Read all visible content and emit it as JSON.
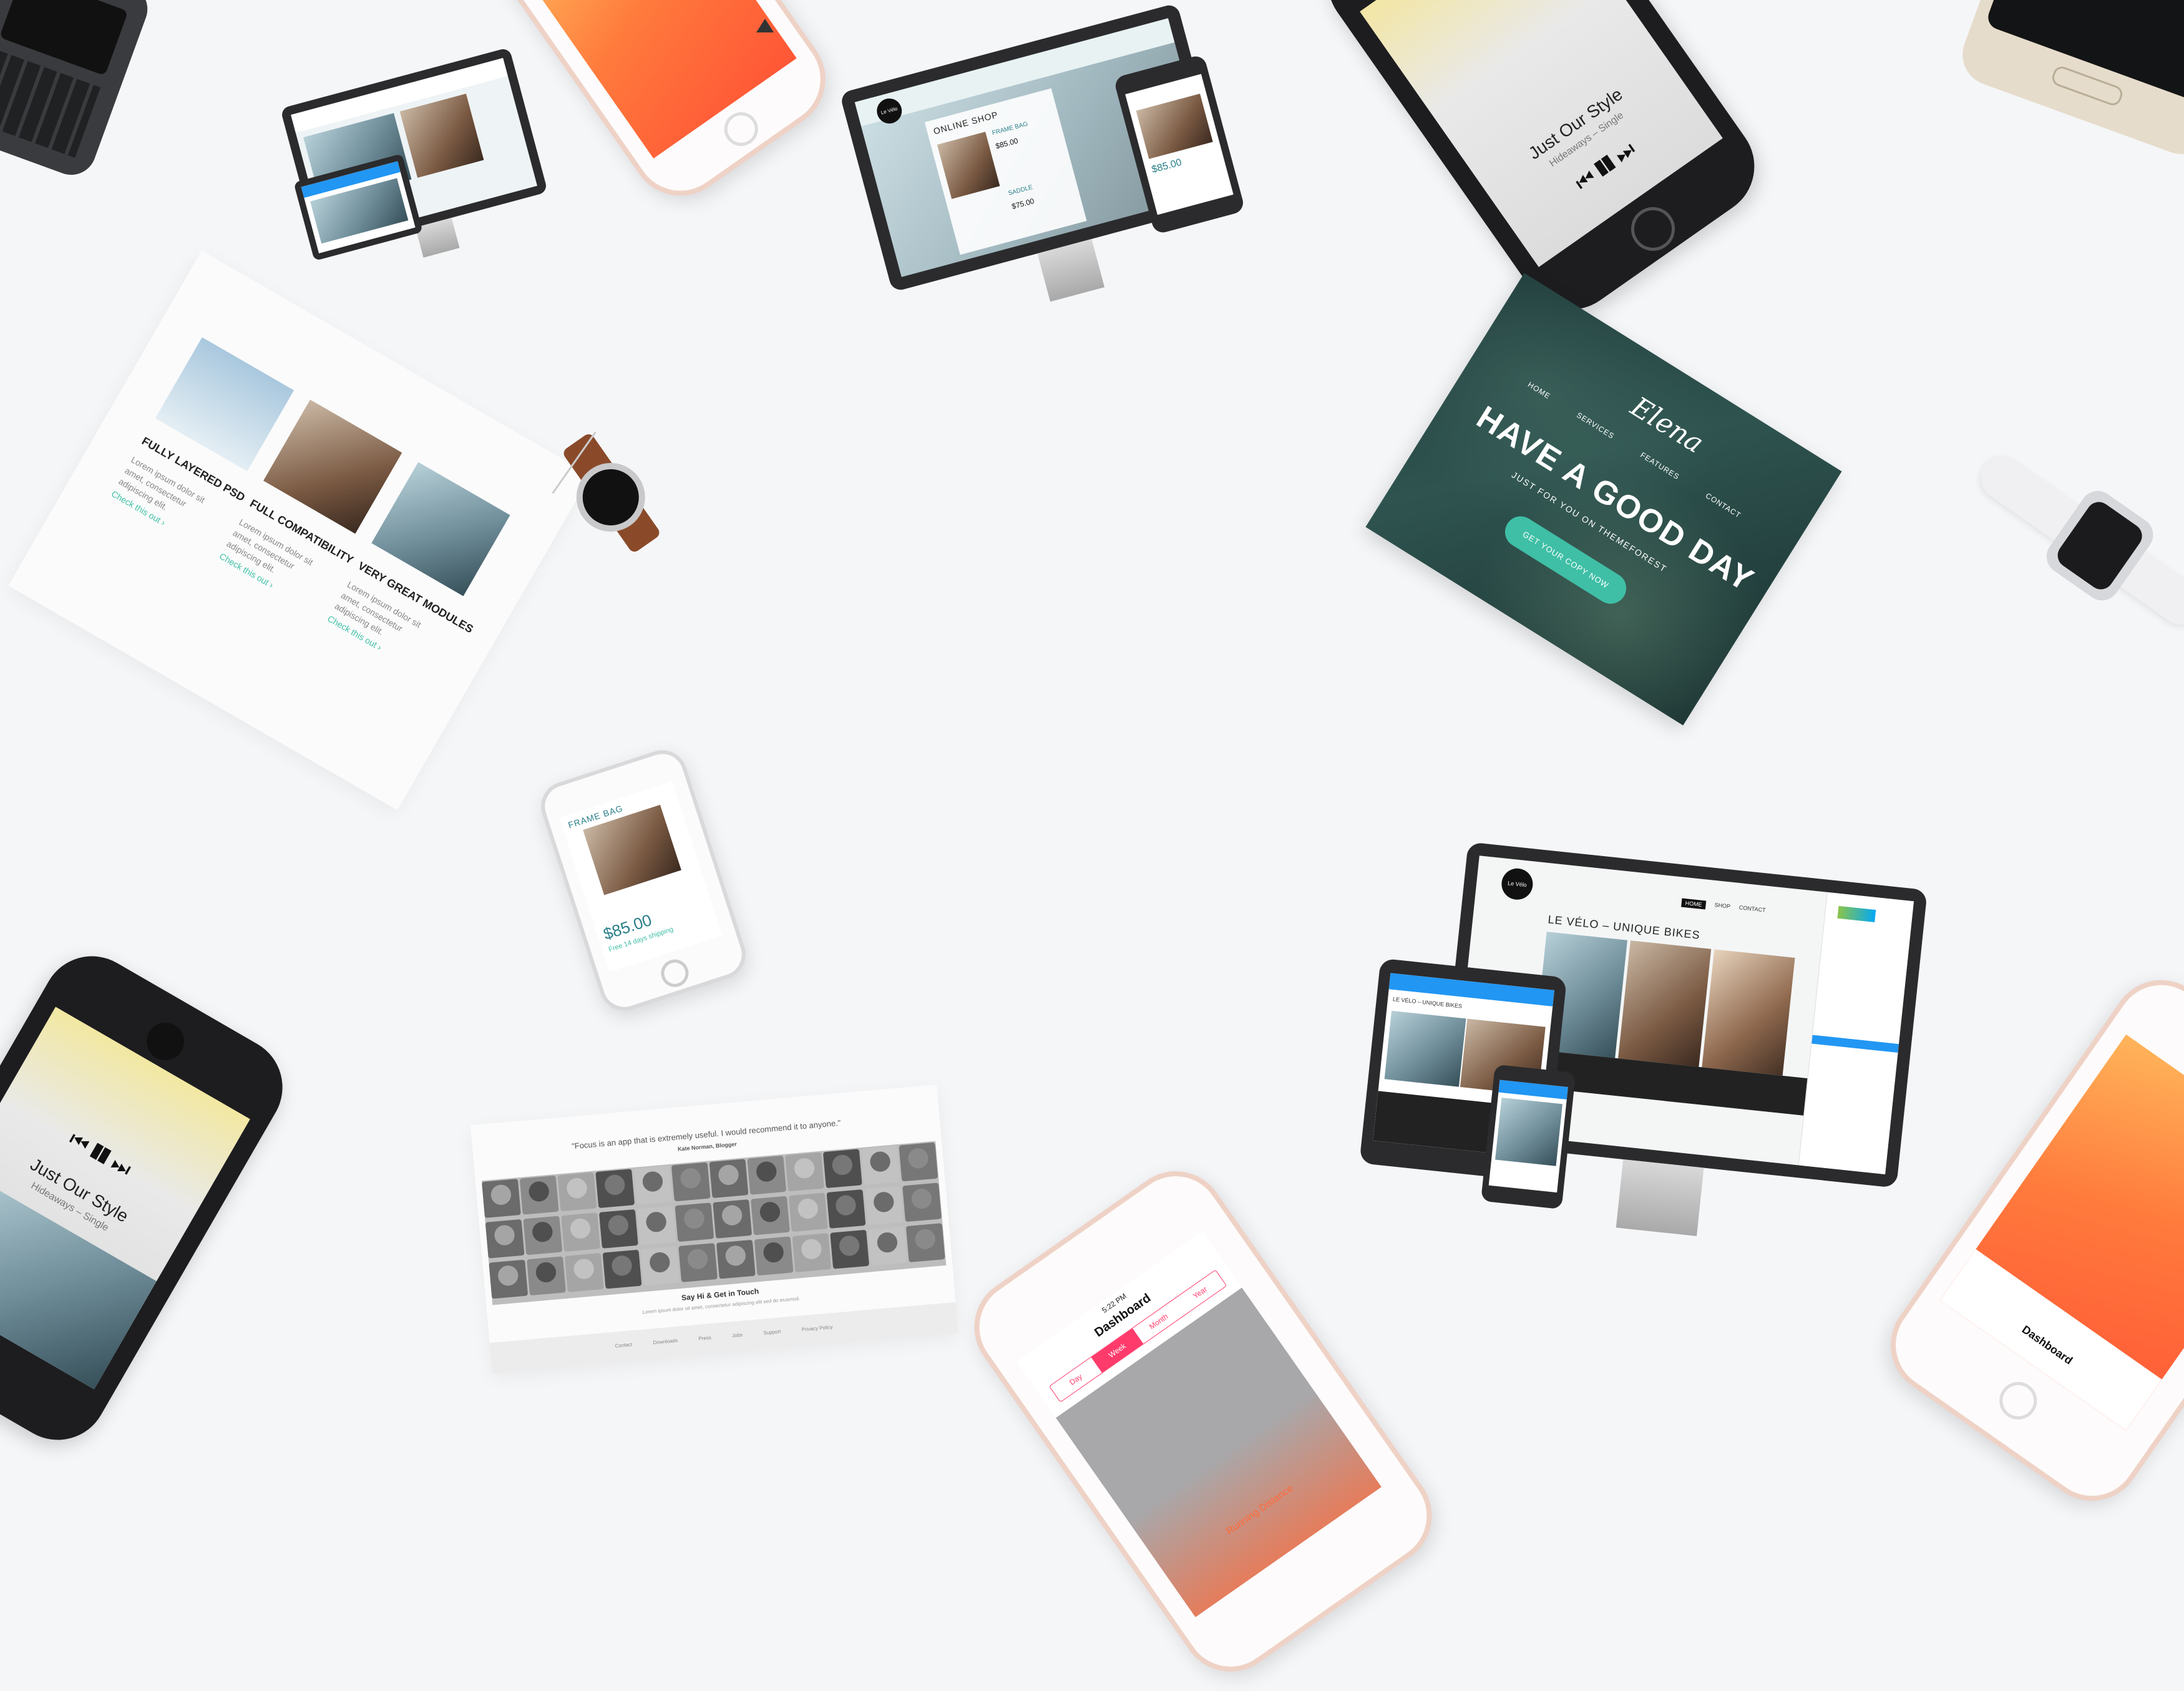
{
  "music_phone_tl": {
    "title": "Just Our Style",
    "subtitle": "Hideaways – Single"
  },
  "music_phone_bl": {
    "title": "Just Our Style",
    "subtitle": "Hideaways – Single"
  },
  "monitor_center": {
    "logo": "Le Vélo",
    "section_title": "ONLINE SHOP",
    "product": "FRAME BAG",
    "price": "$85.00",
    "price2": "$75.00",
    "product2": "SADDLE"
  },
  "feature_card": {
    "items": [
      {
        "title": "FULLY LAYERED PSD",
        "body": "Lorem ipsum dolor sit amet, consectetur adipiscing elit.",
        "link": "Check this out ›"
      },
      {
        "title": "FULL COMPATIBILITY",
        "body": "Lorem ipsum dolor sit amet, consectetur adipiscing elit.",
        "link": "Check this out ›"
      },
      {
        "title": "VERY GREAT MODULES",
        "body": "Lorem ipsum dolor sit amet, consectetur adipiscing elit.",
        "link": "Check this out ›"
      }
    ]
  },
  "hero_card": {
    "logo": "Elena",
    "nav": [
      "HOME",
      "SERVICES",
      "FEATURES",
      "CONTACT"
    ],
    "headline": "HAVE A GOOD DAY",
    "tagline": "JUST FOR YOU ON THEMEFOREST",
    "cta": "GET YOUR COPY NOW",
    "accent": "#3fbfa6"
  },
  "phone_small": {
    "product": "FRAME BAG",
    "price": "$85.00",
    "link": "Free 14 days shipping"
  },
  "testimonial_card": {
    "quote": "\"Focus is an app that is extremely useful. I would recommend it to anyone.\"",
    "author": "Kate Norman, Blogger",
    "heading": "Say Hi & Get in Touch",
    "body": "Lorem ipsum dolor sit amet, consectetur adipiscing elit sed do eiusmod.",
    "footer_links": [
      "Contact",
      "Downloads",
      "Press",
      "Jobs",
      "Support",
      "Privacy Policy"
    ]
  },
  "monitor_right": {
    "logo": "Le Vélo",
    "headline": "LE VÉLO – UNIQUE BIKES",
    "nav": [
      "HOME",
      "SHOP",
      "CONTACT"
    ],
    "tablet_headline": "LE VÉLO – UNIQUE BIKES"
  },
  "fitness_phone": {
    "title": "Dashboard",
    "time": "5:22 PM",
    "tabs": [
      "Day",
      "Week",
      "Month",
      "Year"
    ],
    "active_tab": "Week",
    "footer": "Running Distance"
  },
  "colors": {
    "background": "#f5f6f8",
    "teal_accent": "#3fbfa6",
    "orange_accent": "#ff6a3a",
    "pink_accent": "#ff3b6b",
    "device_dark": "#2b2b2d"
  }
}
